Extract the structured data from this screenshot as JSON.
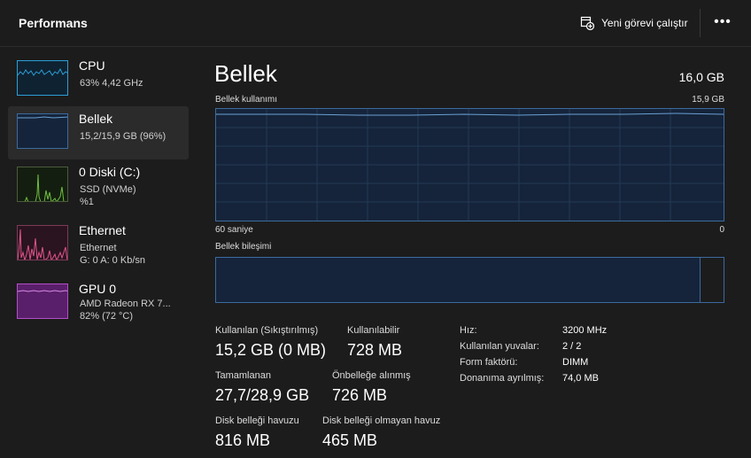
{
  "header": {
    "title": "Performans",
    "run_task_label": "Yeni görevi çalıştır",
    "more_label": "•••"
  },
  "sidebar": {
    "items": [
      {
        "title": "CPU",
        "sub1": "63% 4,42 GHz",
        "sub2": "",
        "color": "#2b9fd6",
        "fill": "#0f2231"
      },
      {
        "title": "Bellek",
        "sub1": "15,2/15,9 GB (96%)",
        "sub2": "",
        "color": "#3d6a9e",
        "fill": "#15243a"
      },
      {
        "title": "0 Diski (C:)",
        "sub1": "SSD (NVMe)",
        "sub2": "%1",
        "color": "#6cbf3e",
        "fill": "#141e10"
      },
      {
        "title": "Ethernet",
        "sub1": "Ethernet",
        "sub2": "G: 0 A: 0 Kb/sn",
        "color": "#e0558c",
        "fill": "#2a1420"
      },
      {
        "title": "GPU 0",
        "sub1": "AMD Radeon RX 7...",
        "sub2": "82% (72 °C)",
        "color": "#b14ec7",
        "fill": "#5a1f6a"
      }
    ]
  },
  "main": {
    "title": "Bellek",
    "total": "16,0 GB",
    "usage_label": "Bellek kullanımı",
    "usage_max": "15,9 GB",
    "axis_left": "60 saniye",
    "axis_right": "0",
    "composition_label": "Bellek bileşimi",
    "composition_in_use_fraction": 0.955,
    "usage_fraction": 0.96,
    "graph_color": "#3d6a9e",
    "stats": {
      "in_use_label": "Kullanılan (Sıkıştırılmış)",
      "in_use_value": "15,2 GB (0 MB)",
      "available_label": "Kullanılabilir",
      "available_value": "728 MB",
      "committed_label": "Tamamlanan",
      "committed_value": "27,7/28,9 GB",
      "cached_label": "Önbelleğe alınmış",
      "cached_value": "726 MB",
      "paged_label": "Disk belleği havuzu",
      "paged_value": "816 MB",
      "nonpaged_label": "Disk belleği olmayan havuz",
      "nonpaged_value": "465 MB"
    },
    "details": [
      {
        "key": "Hız:",
        "value": "3200 MHz"
      },
      {
        "key": "Kullanılan yuvalar:",
        "value": "2 / 2"
      },
      {
        "key": "Form faktörü:",
        "value": "DIMM"
      },
      {
        "key": "Donanıma ayrılmış:",
        "value": "74,0 MB"
      }
    ]
  }
}
